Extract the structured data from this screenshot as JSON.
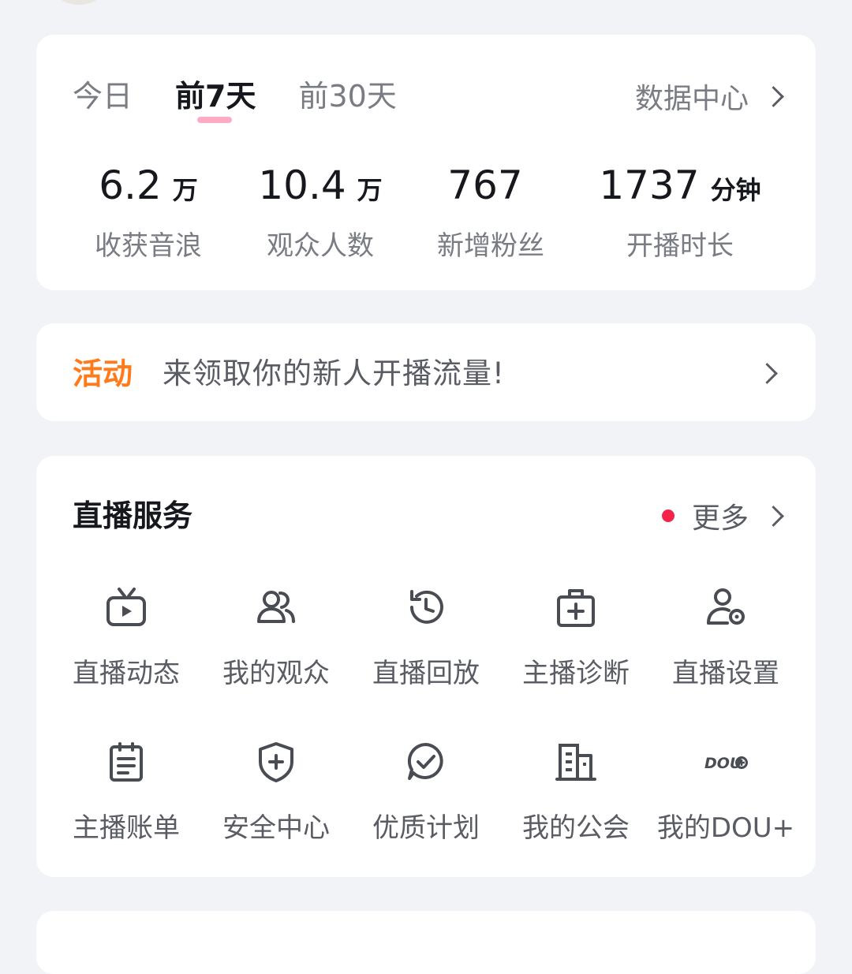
{
  "tabs": [
    {
      "label": "今日",
      "active": false
    },
    {
      "label": "前7天",
      "active": true
    },
    {
      "label": "前30天",
      "active": false
    }
  ],
  "data_center_label": "数据中心",
  "stats": [
    {
      "value": "6.2",
      "unit": "万",
      "label": "收获音浪"
    },
    {
      "value": "10.4",
      "unit": "万",
      "label": "观众人数"
    },
    {
      "value": "767",
      "unit": "",
      "label": "新增粉丝"
    },
    {
      "value": "1737",
      "unit": "分钟",
      "label": "开播时长"
    }
  ],
  "activity": {
    "tag": "活动",
    "text": "来领取你的新人开播流量!"
  },
  "services": {
    "title": "直播服务",
    "more_label": "更多",
    "items": [
      {
        "label": "直播动态",
        "icon": "tv-play-icon"
      },
      {
        "label": "我的观众",
        "icon": "users-icon"
      },
      {
        "label": "直播回放",
        "icon": "history-clock-icon"
      },
      {
        "label": "主播诊断",
        "icon": "medical-kit-icon"
      },
      {
        "label": "直播设置",
        "icon": "user-settings-icon"
      },
      {
        "label": "主播账单",
        "icon": "clipboard-icon"
      },
      {
        "label": "安全中心",
        "icon": "shield-plus-icon"
      },
      {
        "label": "优质计划",
        "icon": "check-bubble-icon"
      },
      {
        "label": "我的公会",
        "icon": "building-icon"
      },
      {
        "label": "我的DOU+",
        "icon": "dou-plus-icon",
        "glyph": "DOU"
      }
    ]
  },
  "colors": {
    "accent_orange": "#ff7a1a",
    "badge_red": "#f5234a",
    "tab_underline_pink": "#ff8fb0"
  }
}
